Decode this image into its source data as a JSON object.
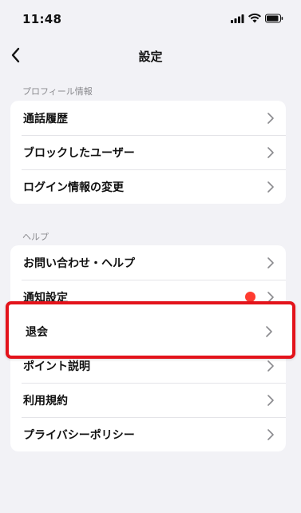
{
  "status_bar": {
    "time": "11:48",
    "icons": [
      "signal-icon",
      "wifi-icon",
      "battery-icon"
    ]
  },
  "nav": {
    "title": "設定",
    "back_icon": "chevron-left-icon"
  },
  "sections": [
    {
      "header": "プロフィール情報",
      "items": [
        {
          "label": "通話履歴"
        },
        {
          "label": "ブロックしたユーザー"
        },
        {
          "label": "ログイン情報の変更"
        }
      ]
    },
    {
      "header": "ヘルプ",
      "items": [
        {
          "label": "お問い合わせ・ヘルプ"
        },
        {
          "label": "通知設定",
          "badge": "red-dot"
        },
        {
          "label": "退会"
        },
        {
          "label": "ポイント説明"
        },
        {
          "label": "利用規約"
        },
        {
          "label": "プライバシーポリシー"
        }
      ]
    }
  ],
  "highlight": {
    "label": "退会",
    "color": "#e3131b"
  },
  "colors": {
    "background": "#f2f2f6",
    "card": "#ffffff",
    "accent_red": "#ff3b30"
  }
}
